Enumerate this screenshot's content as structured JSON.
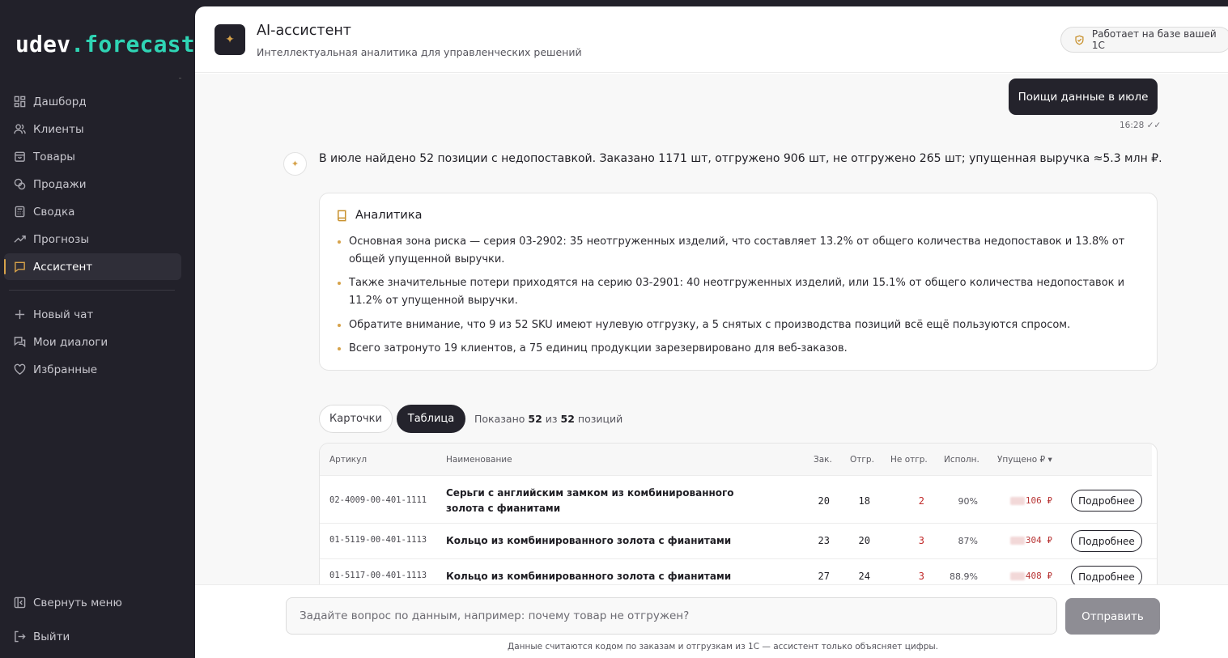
{
  "brand": {
    "name_main": "udev",
    "name_accent": ".forecast",
    "accent_color": "#2fd4b4"
  },
  "sidebar": {
    "items": [
      {
        "label": "Дашборд",
        "icon": "dashboard-icon"
      },
      {
        "label": "Клиенты",
        "icon": "users-icon"
      },
      {
        "label": "Товары",
        "icon": "box-icon"
      },
      {
        "label": "Продажи",
        "icon": "coins-icon"
      },
      {
        "label": "Сводка",
        "icon": "calculator-icon"
      },
      {
        "label": "Прогнозы",
        "icon": "trend-icon"
      },
      {
        "label": "Ассистент",
        "icon": "chat-icon",
        "active": true
      }
    ],
    "secondary": [
      {
        "label": "Новый чат",
        "icon": "plus-icon"
      },
      {
        "label": "Мои диалоги",
        "icon": "dialogs-icon"
      },
      {
        "label": "Избранные",
        "icon": "heart-icon"
      }
    ],
    "collapse_label": "Свернуть меню",
    "logout_label": "Выйти"
  },
  "header": {
    "title": "AI-ассистент",
    "subtitle": "Интеллектуальная аналитика для управленческих решений",
    "badge": "Работает на базе вашей 1С"
  },
  "chat": {
    "user_message": "Поищи данные в июле",
    "user_time": "16:28 ✓✓",
    "ai_message": "В июле найдено 52 позиции с недопоставкой. Заказано 1171 шт, отгружено 906 шт, не отгружено 265 шт; упущенная выручка ≈5.3 млн ₽."
  },
  "analytics": {
    "title": "Аналитика",
    "bullets": [
      "Основная зона риска — серия 03-2902: 35 неотгруженных изделий, что составляет 13.2% от общего количества недопоставок и 13.8% от общей упущенной выручки.",
      "Также значительные потери приходятся на серию 03-2901: 40 неотгруженных изделий, или 15.1% от общего количества недопоставок и 11.2% от упущенной выручки.",
      "Обратите внимание, что 9 из 52 SKU имеют нулевую отгрузку, а 5 снятых с производства позиций всё ещё пользуются спросом.",
      "Всего затронуто 19 клиентов, а 75 единиц продукции зарезервировано для веб-заказов."
    ]
  },
  "view": {
    "cards_label": "Карточки",
    "table_label": "Таблица",
    "shown_prefix": "Показано",
    "shown_count": "52",
    "shown_of": "из",
    "shown_total": "52",
    "shown_suffix": "позиций"
  },
  "table": {
    "columns": [
      "Артикул",
      "Наименование",
      "Зак.",
      "Отгр.",
      "Не отгр.",
      "Исполн.",
      "Упущено ₽ ▾"
    ],
    "rows": [
      {
        "sku": "02-4009-00-401-1111",
        "name": "Серьги с английским замком из комбинированного золота с фианитами",
        "ordered": "20",
        "shipped": "18",
        "not_shipped": "2",
        "fulfillment": "90%",
        "lost": "106 ₽",
        "action": "Подробнее"
      },
      {
        "sku": "01-5119-00-401-1113",
        "name": "Кольцо из комбинированного золота с фианитами",
        "ordered": "23",
        "shipped": "20",
        "not_shipped": "3",
        "fulfillment": "87%",
        "lost": "304 ₽",
        "action": "Подробнее"
      },
      {
        "sku": "01-5117-00-401-1113",
        "name": "Кольцо из комбинированного золота с фианитами",
        "ordered": "27",
        "shipped": "24",
        "not_shipped": "3",
        "fulfillment": "88.9%",
        "lost": "408 ₽",
        "action": "Подробнее"
      }
    ]
  },
  "composer": {
    "placeholder": "Задайте вопрос по данным, например: почему товар не отгружен?",
    "send_label": "Отправить",
    "note": "Данные считаются кодом по заказам и отгрузкам из 1С — ассистент только объясняет цифры."
  }
}
